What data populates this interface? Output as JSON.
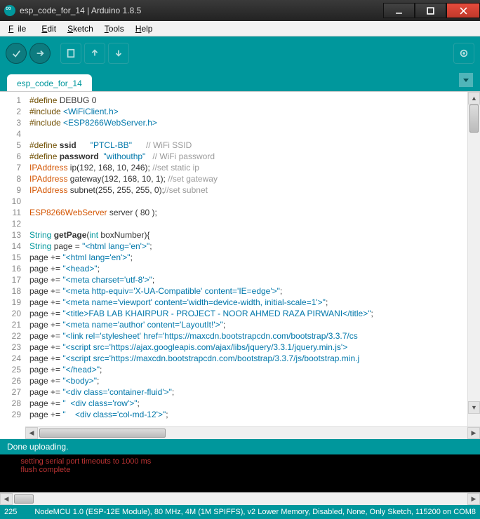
{
  "window": {
    "title": "esp_code_for_14 | Arduino 1.8.5"
  },
  "menu": {
    "file": "File",
    "edit": "Edit",
    "sketch": "Sketch",
    "tools": "Tools",
    "help": "Help"
  },
  "tab": {
    "name": "esp_code_for_14"
  },
  "code_lines": [
    {
      "n": 1,
      "h": "<span class='pre'>#define</span> DEBUG 0"
    },
    {
      "n": 2,
      "h": "<span class='pre'>#include</span> <span class='st'>&lt;WiFiClient.h&gt;</span>"
    },
    {
      "n": 3,
      "h": "<span class='pre'>#include</span> <span class='st'>&lt;ESP8266WebServer.h&gt;</span>"
    },
    {
      "n": 4,
      "h": ""
    },
    {
      "n": 5,
      "h": "<span class='pre'>#define</span> <span class='fn'>ssid</span>      <span class='st'>\"PTCL-BB\"</span>      <span class='cm'>// WiFi SSID</span>"
    },
    {
      "n": 6,
      "h": "<span class='pre'>#define</span> <span class='fn'>password</span>  <span class='st'>\"withouthp\"</span>   <span class='cm'>// WiFi password</span>"
    },
    {
      "n": 7,
      "h": "<span class='ty'>IPAddress</span> ip(192, 168, 10, 246); <span class='cm'>//set static ip</span>"
    },
    {
      "n": 8,
      "h": "<span class='ty'>IPAddress</span> gateway(192, 168, 10, 1); <span class='cm'>//set gateway</span>"
    },
    {
      "n": 9,
      "h": "<span class='ty'>IPAddress</span> subnet(255, 255, 255, 0);<span class='cm'>//set subnet</span>"
    },
    {
      "n": 10,
      "h": ""
    },
    {
      "n": 11,
      "h": "<span class='ty'>ESP8266WebServer</span> server ( 80 );"
    },
    {
      "n": 12,
      "h": ""
    },
    {
      "n": 13,
      "h": "<span class='kw'>String</span> <span class='fn'>getPage</span>(<span class='kw'>int</span> boxNumber){"
    },
    {
      "n": 14,
      "h": "<span class='kw'>String</span> page = <span class='st'>\"&lt;html lang='en'&gt;\"</span>;"
    },
    {
      "n": 15,
      "h": "page += <span class='st'>\"&lt;html lang='en'&gt;\"</span>;"
    },
    {
      "n": 16,
      "h": "page += <span class='st'>\"&lt;head&gt;\"</span>;"
    },
    {
      "n": 17,
      "h": "page += <span class='st'>\"&lt;meta charset='utf-8'&gt;\"</span>;"
    },
    {
      "n": 18,
      "h": "page += <span class='st'>\"&lt;meta http-equiv='X-UA-Compatible' content='IE=edge'&gt;\"</span>;"
    },
    {
      "n": 19,
      "h": "page += <span class='st'>\"&lt;meta name='viewport' content='width=device-width, initial-scale=1'&gt;\"</span>;"
    },
    {
      "n": 20,
      "h": "page += <span class='st'>\"&lt;title&gt;FAB LAB KHAIRPUR - PROJECT - NOOR AHMED RAZA PIRWANI&lt;/title&gt;\"</span>;"
    },
    {
      "n": 21,
      "h": "page += <span class='st'>\"&lt;meta name='author' content='LayoutIt!'&gt;\"</span>;"
    },
    {
      "n": 22,
      "h": "page += <span class='st'>\"&lt;link rel='stylesheet' href='https://maxcdn.bootstrapcdn.com/bootstrap/3.3.7/cs</span>"
    },
    {
      "n": 23,
      "h": "page += <span class='st'>\"&lt;script src='https://ajax.googleapis.com/ajax/libs/jquery/3.3.1/jquery.min.js'&gt;</span>"
    },
    {
      "n": 24,
      "h": "page += <span class='st'>\"&lt;script src='https://maxcdn.bootstrapcdn.com/bootstrap/3.3.7/js/bootstrap.min.j</span>"
    },
    {
      "n": 25,
      "h": "page += <span class='st'>\"&lt;/head&gt;\"</span>;"
    },
    {
      "n": 26,
      "h": "page += <span class='st'>\"&lt;body&gt;\"</span>;"
    },
    {
      "n": 27,
      "h": "page += <span class='st'>\"&lt;div class='container-fluid'&gt;\"</span>;"
    },
    {
      "n": 28,
      "h": "page += <span class='st'>\"  &lt;div class='row'&gt;\"</span>;"
    },
    {
      "n": 29,
      "h": "page += <span class='st'>\"    &lt;div class='col-md-12'&gt;\"</span>;"
    }
  ],
  "status": {
    "upload": "Done uploading."
  },
  "console_lines": [
    "       setting serial port timeouts to 1000 ms",
    "       flush complete"
  ],
  "bottom": {
    "line": "225",
    "board": "NodeMCU 1.0 (ESP-12E Module), 80 MHz, 4M (1M SPIFFS), v2 Lower Memory, Disabled, None, Only Sketch, 115200 on COM8"
  }
}
